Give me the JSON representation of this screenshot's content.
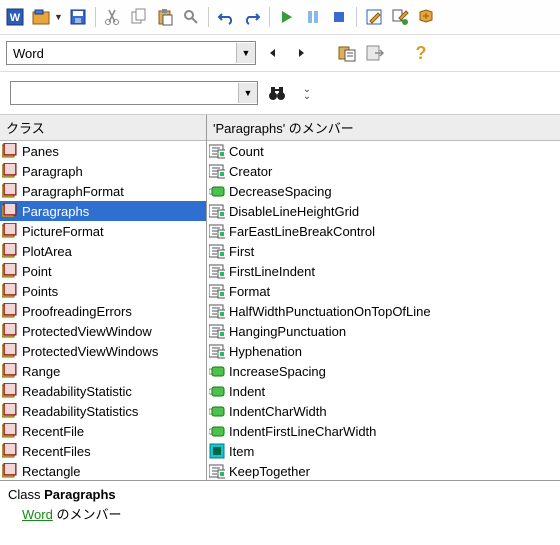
{
  "library_combo": "Word",
  "search_value": "",
  "left": {
    "header": "クラス",
    "selected": "Paragraphs",
    "items": [
      {
        "name": "Panes",
        "icon": "class"
      },
      {
        "name": "Paragraph",
        "icon": "class"
      },
      {
        "name": "ParagraphFormat",
        "icon": "class"
      },
      {
        "name": "Paragraphs",
        "icon": "class"
      },
      {
        "name": "PictureFormat",
        "icon": "class"
      },
      {
        "name": "PlotArea",
        "icon": "class"
      },
      {
        "name": "Point",
        "icon": "class"
      },
      {
        "name": "Points",
        "icon": "class"
      },
      {
        "name": "ProofreadingErrors",
        "icon": "class"
      },
      {
        "name": "ProtectedViewWindow",
        "icon": "class"
      },
      {
        "name": "ProtectedViewWindows",
        "icon": "class"
      },
      {
        "name": "Range",
        "icon": "class"
      },
      {
        "name": "ReadabilityStatistic",
        "icon": "class"
      },
      {
        "name": "ReadabilityStatistics",
        "icon": "class"
      },
      {
        "name": "RecentFile",
        "icon": "class"
      },
      {
        "name": "RecentFiles",
        "icon": "class"
      },
      {
        "name": "Rectangle",
        "icon": "class"
      }
    ]
  },
  "right": {
    "header": "'Paragraphs' のメンバー",
    "items": [
      {
        "name": "Count",
        "icon": "prop"
      },
      {
        "name": "Creator",
        "icon": "prop"
      },
      {
        "name": "DecreaseSpacing",
        "icon": "method"
      },
      {
        "name": "DisableLineHeightGrid",
        "icon": "prop"
      },
      {
        "name": "FarEastLineBreakControl",
        "icon": "prop"
      },
      {
        "name": "First",
        "icon": "prop"
      },
      {
        "name": "FirstLineIndent",
        "icon": "prop"
      },
      {
        "name": "Format",
        "icon": "prop"
      },
      {
        "name": "HalfWidthPunctuationOnTopOfLine",
        "icon": "prop"
      },
      {
        "name": "HangingPunctuation",
        "icon": "prop"
      },
      {
        "name": "Hyphenation",
        "icon": "prop"
      },
      {
        "name": "IncreaseSpacing",
        "icon": "method"
      },
      {
        "name": "Indent",
        "icon": "method"
      },
      {
        "name": "IndentCharWidth",
        "icon": "method"
      },
      {
        "name": "IndentFirstLineCharWidth",
        "icon": "method"
      },
      {
        "name": "Item",
        "icon": "default"
      },
      {
        "name": "KeepTogether",
        "icon": "prop"
      }
    ]
  },
  "details": {
    "prefix": "Class ",
    "class_name": "Paragraphs",
    "link_text": "Word",
    "suffix": " のメンバー"
  }
}
